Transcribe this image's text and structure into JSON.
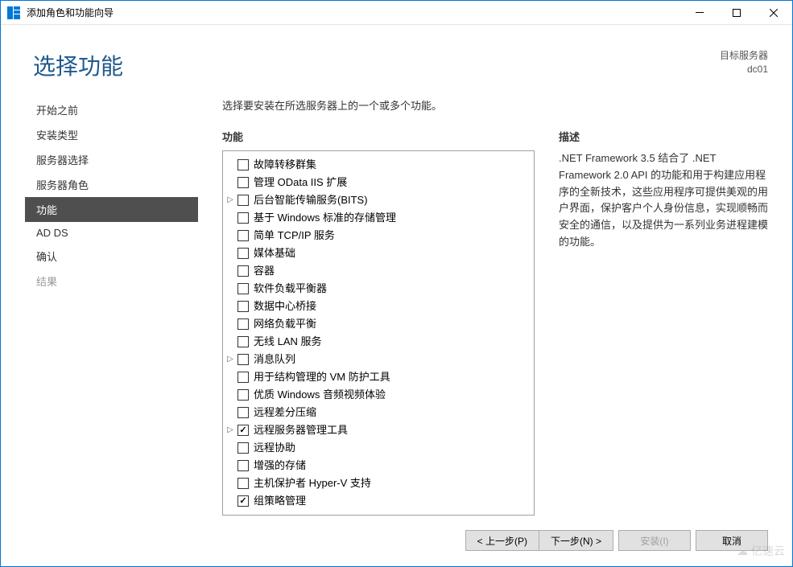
{
  "window": {
    "title": "添加角色和功能向导"
  },
  "header": {
    "page_title": "选择功能",
    "target_label": "目标服务器",
    "target_name": "dc01"
  },
  "sidebar": {
    "items": [
      {
        "label": "开始之前",
        "state": "normal"
      },
      {
        "label": "安装类型",
        "state": "normal"
      },
      {
        "label": "服务器选择",
        "state": "normal"
      },
      {
        "label": "服务器角色",
        "state": "normal"
      },
      {
        "label": "功能",
        "state": "active"
      },
      {
        "label": "AD DS",
        "state": "normal"
      },
      {
        "label": "确认",
        "state": "normal"
      },
      {
        "label": "结果",
        "state": "disabled"
      }
    ]
  },
  "main": {
    "instruction": "选择要安装在所选服务器上的一个或多个功能。",
    "features_heading": "功能",
    "description_heading": "描述",
    "description_text": ".NET Framework 3.5 结合了 .NET Framework 2.0 API 的功能和用于构建应用程序的全新技术，这些应用程序可提供美观的用户界面，保护客户个人身份信息，实现顺畅而安全的通信，以及提供为一系列业务进程建模的功能。"
  },
  "features": [
    {
      "label": "故障转移群集",
      "checked": false,
      "expandable": false
    },
    {
      "label": "管理 OData IIS 扩展",
      "checked": false,
      "expandable": false
    },
    {
      "label": "后台智能传输服务(BITS)",
      "checked": false,
      "expandable": true
    },
    {
      "label": "基于 Windows 标准的存储管理",
      "checked": false,
      "expandable": false
    },
    {
      "label": "简单 TCP/IP 服务",
      "checked": false,
      "expandable": false
    },
    {
      "label": "媒体基础",
      "checked": false,
      "expandable": false
    },
    {
      "label": "容器",
      "checked": false,
      "expandable": false
    },
    {
      "label": "软件负载平衡器",
      "checked": false,
      "expandable": false
    },
    {
      "label": "数据中心桥接",
      "checked": false,
      "expandable": false
    },
    {
      "label": "网络负载平衡",
      "checked": false,
      "expandable": false
    },
    {
      "label": "无线 LAN 服务",
      "checked": false,
      "expandable": false
    },
    {
      "label": "消息队列",
      "checked": false,
      "expandable": true
    },
    {
      "label": "用于结构管理的 VM 防护工具",
      "checked": false,
      "expandable": false
    },
    {
      "label": "优质 Windows 音频视频体验",
      "checked": false,
      "expandable": false
    },
    {
      "label": "远程差分压缩",
      "checked": false,
      "expandable": false
    },
    {
      "label": "远程服务器管理工具",
      "checked": true,
      "expandable": true
    },
    {
      "label": "远程协助",
      "checked": false,
      "expandable": false
    },
    {
      "label": "增强的存储",
      "checked": false,
      "expandable": false
    },
    {
      "label": "主机保护者 Hyper-V 支持",
      "checked": false,
      "expandable": false
    },
    {
      "label": "组策略管理",
      "checked": true,
      "expandable": false
    }
  ],
  "footer": {
    "previous": "< 上一步(P)",
    "next": "下一步(N) >",
    "install": "安装(I)",
    "cancel": "取消"
  },
  "watermark": "亿速云"
}
